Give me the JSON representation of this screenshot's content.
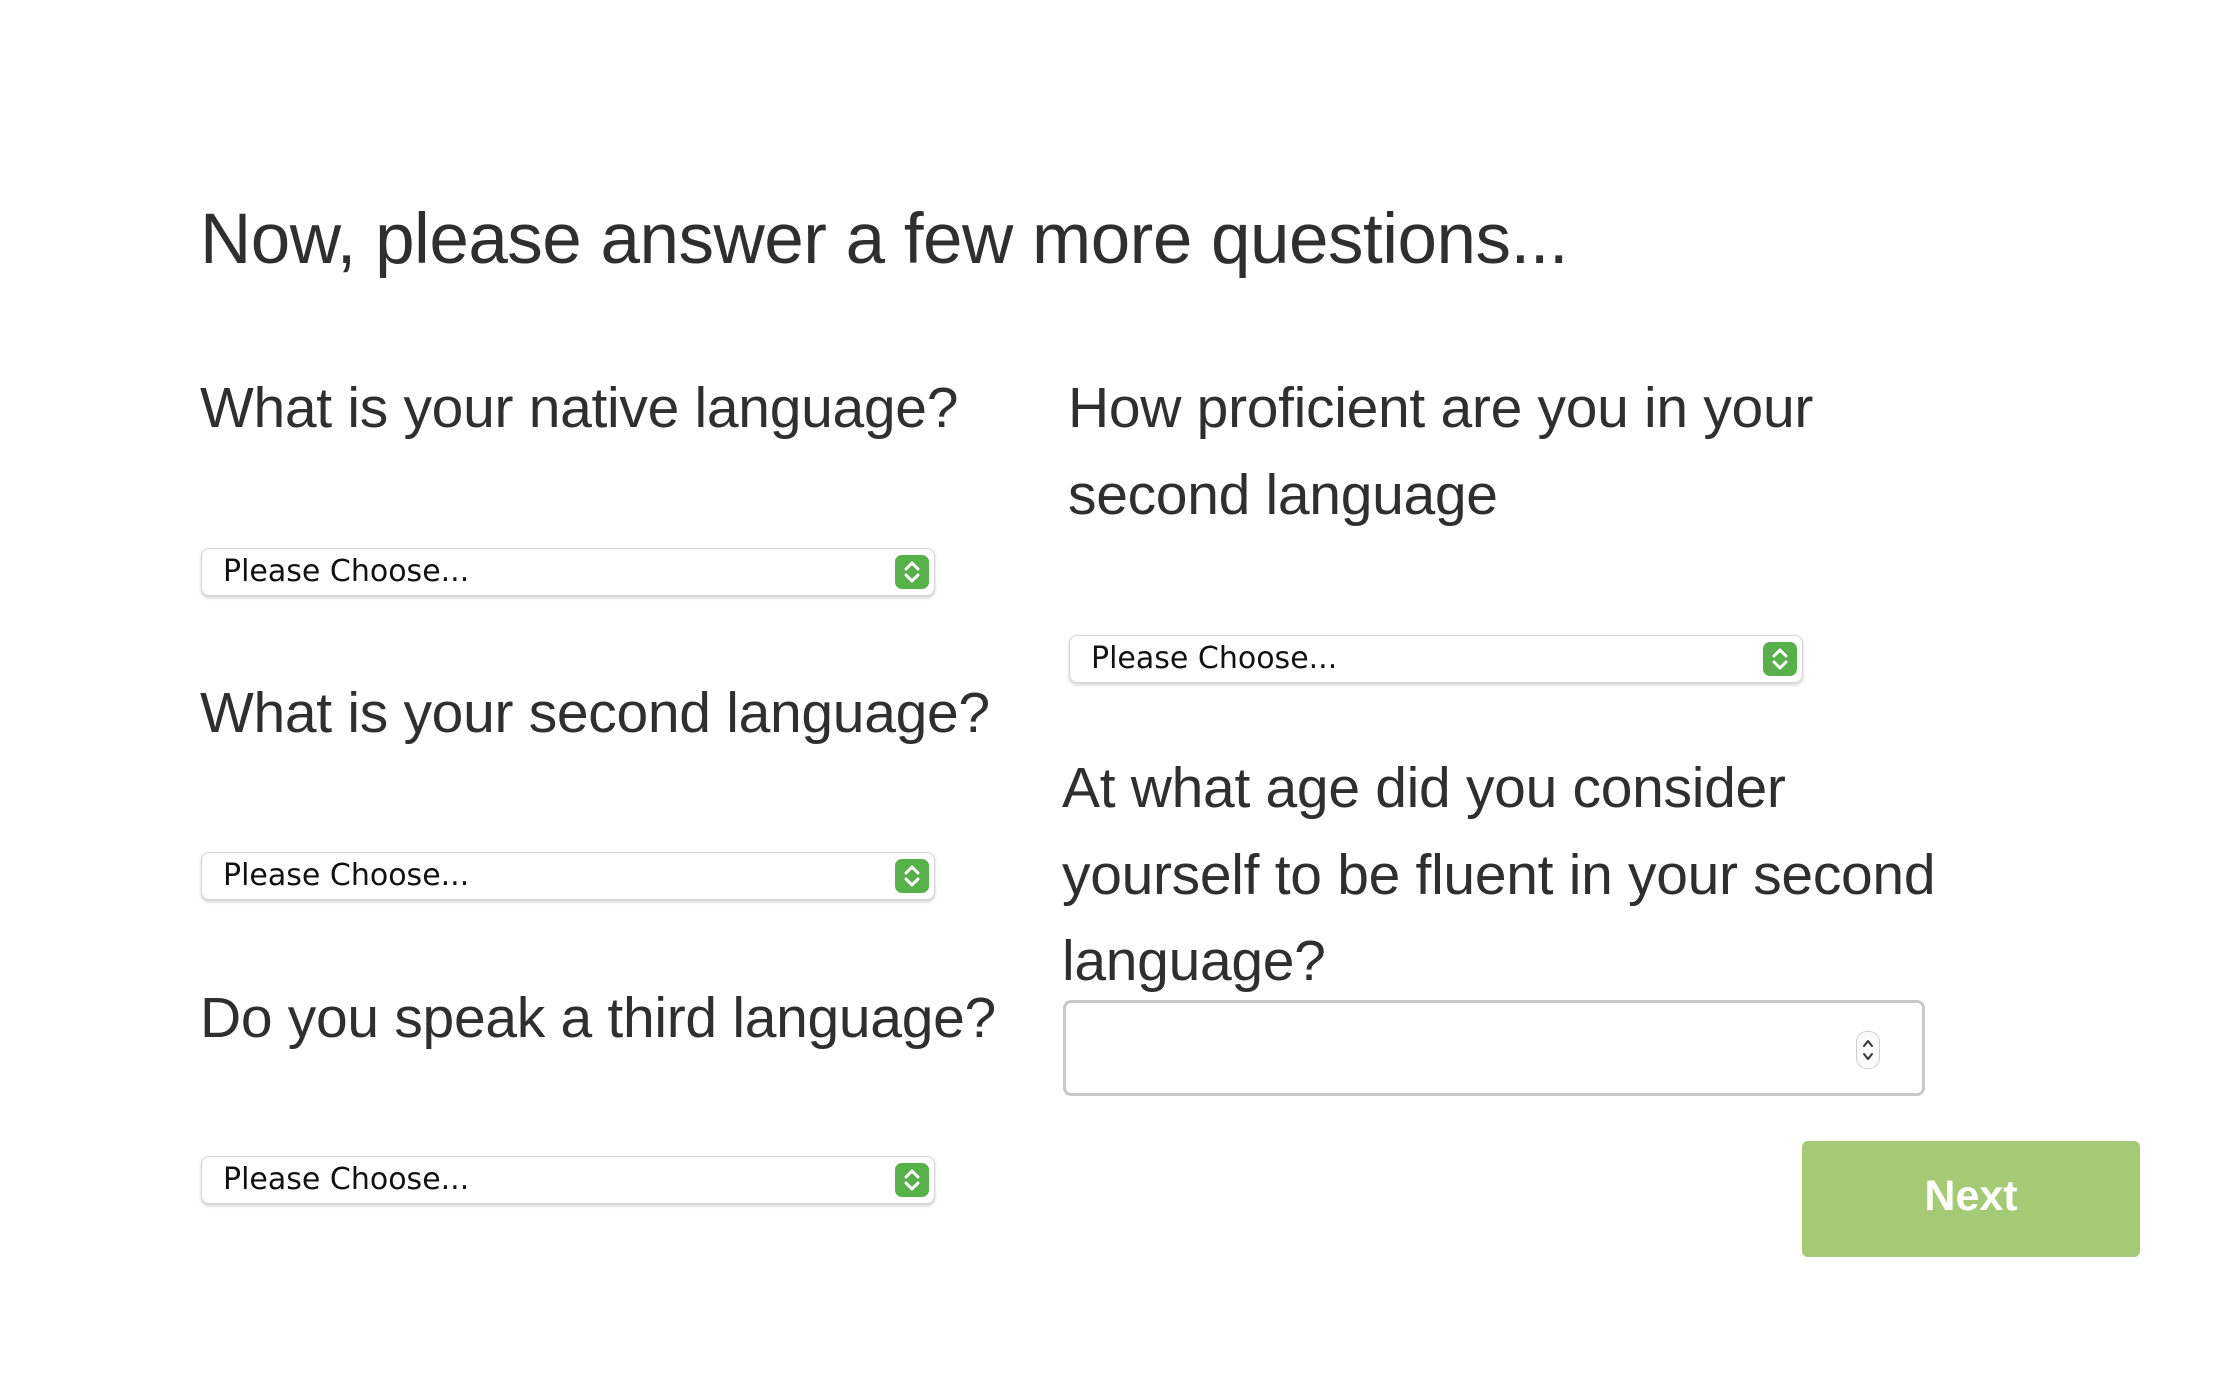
{
  "header": {
    "title": "Now, please answer a few more questions..."
  },
  "questions": {
    "native_language": {
      "label": "What is your native language?",
      "selected": "Please Choose..."
    },
    "second_language": {
      "label": "What is your second language?",
      "selected": "Please Choose..."
    },
    "third_language": {
      "label": "Do you speak a third language?",
      "selected": "Please Choose..."
    },
    "proficiency": {
      "label_line1": "How proficient are you in your",
      "label_line2": "second language",
      "selected": "Please Choose..."
    },
    "fluency_age": {
      "label_line1": "At what age did you consider",
      "label_line2": "yourself to be fluent in your second",
      "label_line3": "language?",
      "value": ""
    }
  },
  "actions": {
    "next_label": "Next"
  },
  "colors": {
    "accent_green": "#58b04a",
    "button_green": "#a5c974",
    "text": "#2f2f2f"
  },
  "icons": {
    "select_arrows": "updown-chevron-icon",
    "number_spinner": "spinner-arrows-icon"
  }
}
